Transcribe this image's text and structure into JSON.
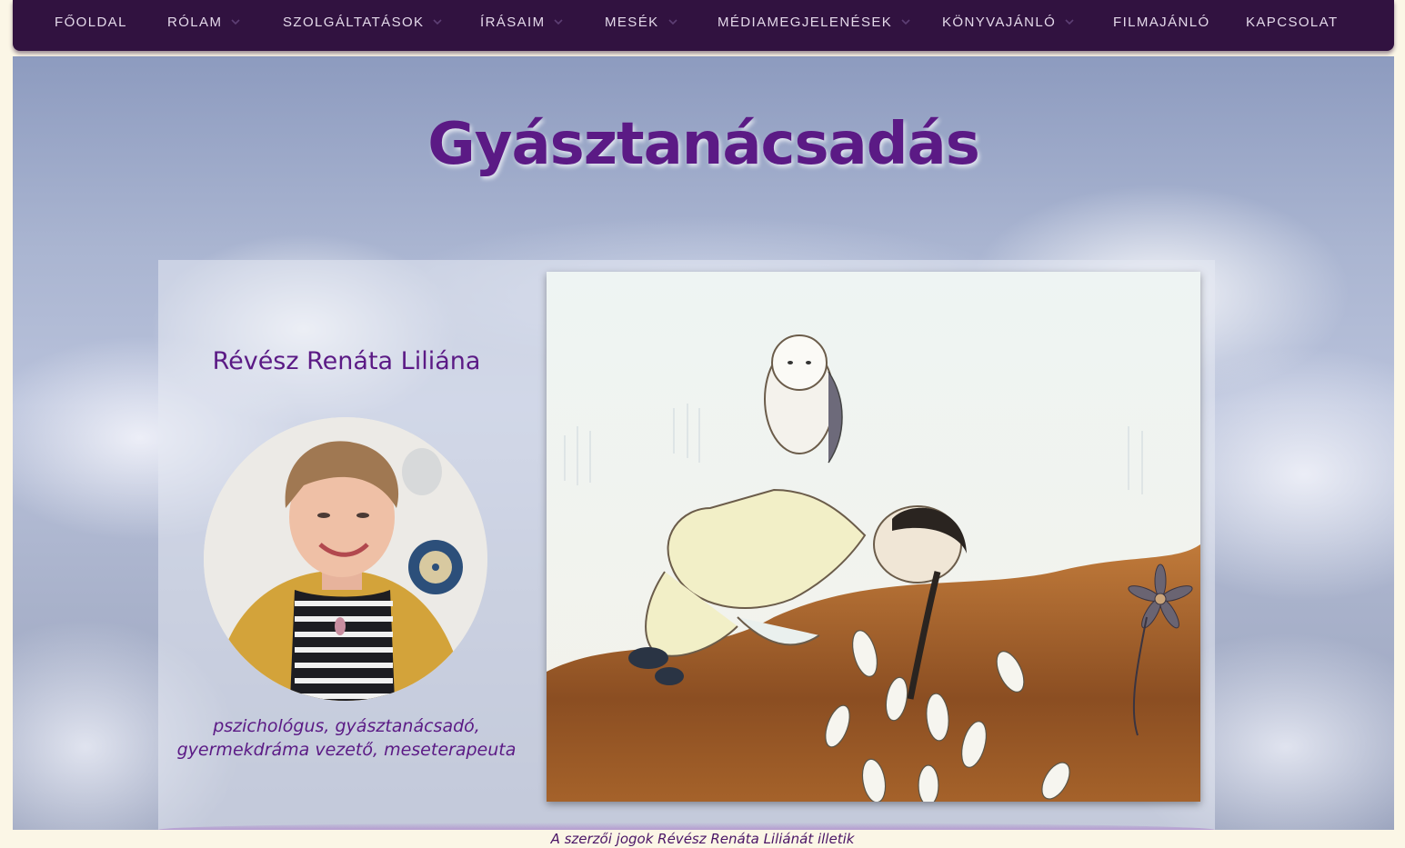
{
  "nav": {
    "items": [
      {
        "label": "FŐOLDAL",
        "has_dropdown": false
      },
      {
        "label": "RÓLAM",
        "has_dropdown": true
      },
      {
        "label": "SZOLGÁLTATÁSOK",
        "has_dropdown": true
      },
      {
        "label": "ÍRÁSAIM",
        "has_dropdown": true
      },
      {
        "label": "MESÉK",
        "has_dropdown": true
      },
      {
        "label": "MÉDIAMEGJELENÉSEK",
        "has_dropdown": true
      },
      {
        "label": "KÖNYVAJÁNLÓ",
        "has_dropdown": true
      },
      {
        "label": "FILMAJÁNLÓ",
        "has_dropdown": false
      },
      {
        "label": "KAPCSOLAT",
        "has_dropdown": false
      }
    ]
  },
  "hero": {
    "title": "Gyásztanácsadás"
  },
  "author": {
    "name": "Révész Renáta Liliána",
    "role_line1": "pszichológus, gyásztanácsadó,",
    "role_line2": "gyermekdráma vezető, meseterapeuta"
  },
  "footer": {
    "copyright": "A szerzői jogok Révész Renáta Liliánát illetik"
  },
  "colors": {
    "nav_bg": "#311240",
    "accent_purple": "#5b1a85",
    "page_bg": "#fbf6e6"
  }
}
